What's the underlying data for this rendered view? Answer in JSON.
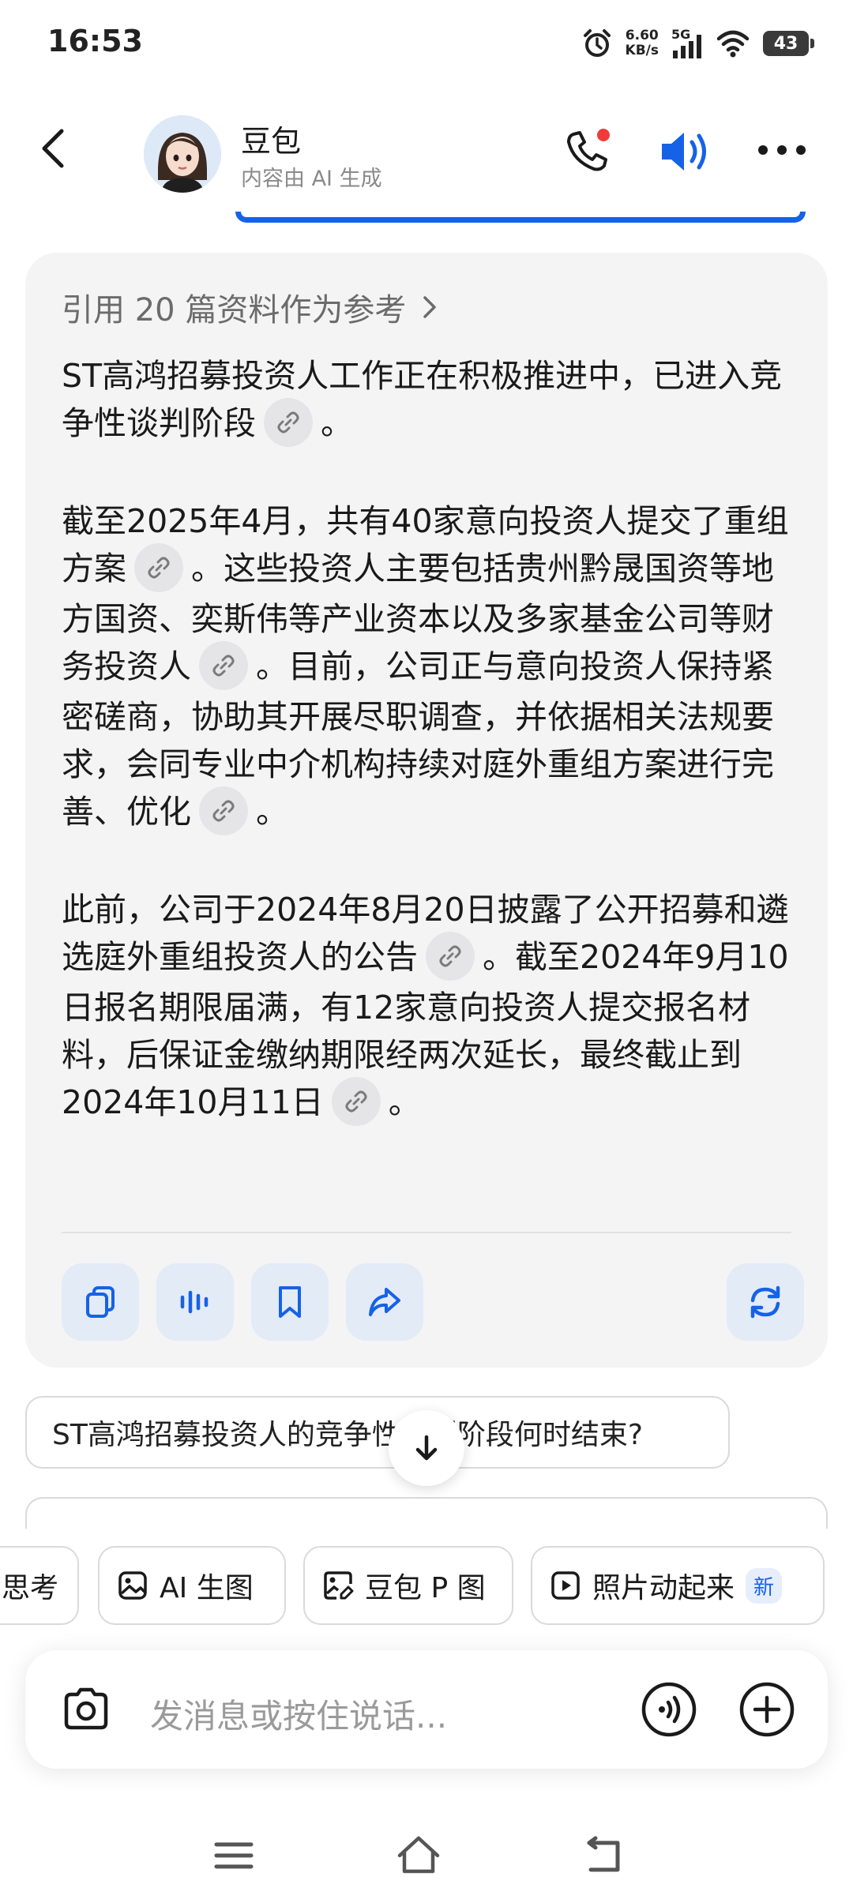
{
  "status_bar": {
    "time": "16:53",
    "net_speed_value": "6.60",
    "net_speed_unit": "KB/s",
    "network": "5G",
    "battery": "43",
    "icons": [
      "alarm-icon",
      "signal-icon",
      "wifi-icon",
      "battery-icon"
    ]
  },
  "header": {
    "title": "豆包",
    "subtitle": "内容由 AI 生成",
    "icons": [
      "back-icon",
      "avatar",
      "phone-icon",
      "speaker-icon",
      "more-icon"
    ],
    "accent_color": "#1662e7",
    "notification_dot_color": "#f03b3b"
  },
  "answer": {
    "references_label": "引用 20 篇资料作为参考",
    "p1_a": "ST高鸿招募投资人工作正在积极推进中，已进入竞争性谈判阶段",
    "p1_b": "。",
    "p2_a": "截至2025年4月，共有40家意向投资人提交了重组方案",
    "p2_b": "。这些投资人主要包括贵州黔晟国资等地方国资、奕斯伟等产业资本以及多家基金公司等财务投资人",
    "p2_c": "。目前，公司正与意向投资人保持紧密磋商，协助其开展尽职调查，并依据相关法规要求，会同专业中介机构持续对庭外重组方案进行完善、优化",
    "p2_d": "。",
    "p3_a": "此前，公司于2024年8月20日披露了公开招募和遴选庭外重组投资人的公告",
    "p3_b": "。截至2024年9月10日报名期限届满，有12家意向投资人提交报名材料，后保证金缴纳期限经两次延长，最终截止到2024年10月11日",
    "p3_c": "。",
    "actions": [
      "copy-icon",
      "read-aloud-icon",
      "bookmark-icon",
      "share-icon",
      "regenerate-icon"
    ]
  },
  "suggestions": {
    "q1": "ST高鸿招募投资人的竞争性谈判阶段何时结束?"
  },
  "tools": {
    "t0": "思考",
    "t1": "AI 生图",
    "t2": "豆包 P 图",
    "t3": "照片动起来",
    "t3_badge": "新"
  },
  "input": {
    "placeholder": "发消息或按住说话..."
  },
  "nav": [
    "menu-icon",
    "home-icon",
    "back-nav-icon"
  ]
}
